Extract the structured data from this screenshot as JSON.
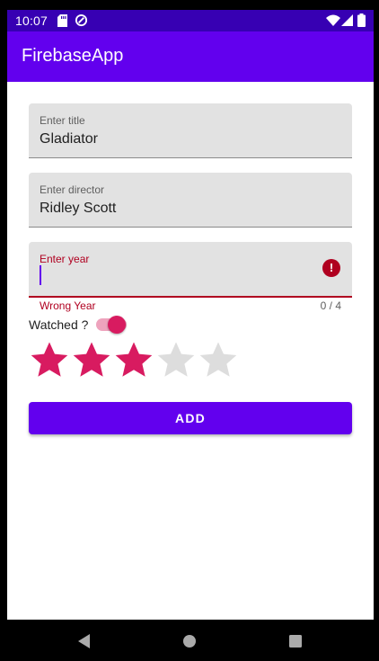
{
  "status_bar": {
    "time": "10:07",
    "icons": [
      "sd-card-icon",
      "sync-icon",
      "wifi-icon",
      "signal-icon",
      "battery-icon"
    ]
  },
  "app_bar": {
    "title": "FirebaseApp"
  },
  "form": {
    "title_field": {
      "label": "Enter title",
      "value": "Gladiator"
    },
    "director_field": {
      "label": "Enter director",
      "value": "Ridley Scott"
    },
    "year_field": {
      "label": "Enter year",
      "value": "",
      "error": "Wrong Year",
      "counter": "0 / 4",
      "max_length": 4,
      "has_error": true
    },
    "watched": {
      "label": "Watched ?",
      "checked": true
    },
    "rating": {
      "value": 3,
      "max": 5
    },
    "add_button": {
      "label": "ADD"
    }
  },
  "nav_bar": {
    "buttons": [
      "back",
      "home",
      "recents"
    ]
  },
  "colors": {
    "status_bar": "#3700b3",
    "primary": "#6200ee",
    "accent": "#d81b60",
    "error": "#b00020",
    "field_background": "#e2e2e2",
    "star_empty": "#dddddd"
  }
}
